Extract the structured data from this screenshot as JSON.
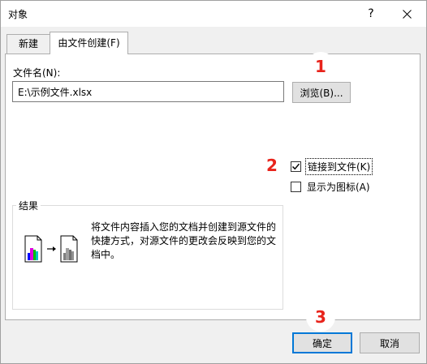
{
  "window": {
    "title": "对象",
    "help_symbol": "?"
  },
  "tabs": [
    {
      "label": "新建(C)",
      "active": false
    },
    {
      "label": "由文件创建(F)",
      "active": true
    }
  ],
  "file": {
    "label": "文件名(N):",
    "value": "E:\\示例文件.xlsx",
    "browse_label": "浏览(B)..."
  },
  "options": {
    "link_label": "链接到文件(K)",
    "link_checked": true,
    "icon_label": "显示为图标(A)",
    "icon_checked": false
  },
  "result": {
    "title": "结果",
    "description": "将文件内容插入您的文档并创建到源文件的快捷方式，对源文件的更改会反映到您的文档中。"
  },
  "markers": [
    "1",
    "2",
    "3"
  ],
  "buttons": {
    "ok": "确定",
    "cancel": "取消"
  },
  "colors": {
    "marker": "#e8231b",
    "focus_blue": "#0078d7"
  }
}
